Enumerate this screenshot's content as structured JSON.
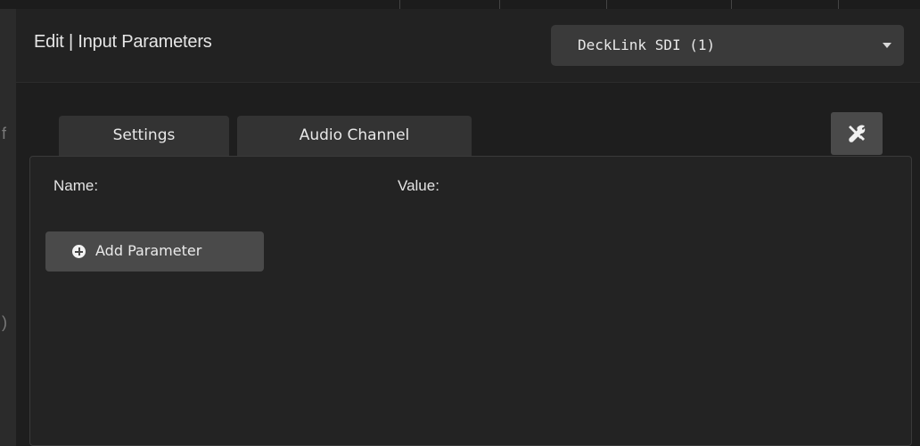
{
  "dialog": {
    "title": "Edit | Input Parameters",
    "device_select": {
      "value": "DeckLink SDI (1)",
      "icon": "caret-down-icon"
    }
  },
  "tabs": [
    {
      "label": "Settings"
    },
    {
      "label": "Audio Channel"
    }
  ],
  "tools_button": {
    "icon": "tools-icon"
  },
  "parameters": {
    "name_header": "Name:",
    "value_header": "Value:",
    "add_button_label": "Add Parameter",
    "add_button_icon": "plus-circle-icon"
  },
  "colors": {
    "dialog_background": "#1e1e1e",
    "panel_background": "#232323",
    "button_background": "#4a4a4a",
    "text": "#e6e6e6"
  }
}
